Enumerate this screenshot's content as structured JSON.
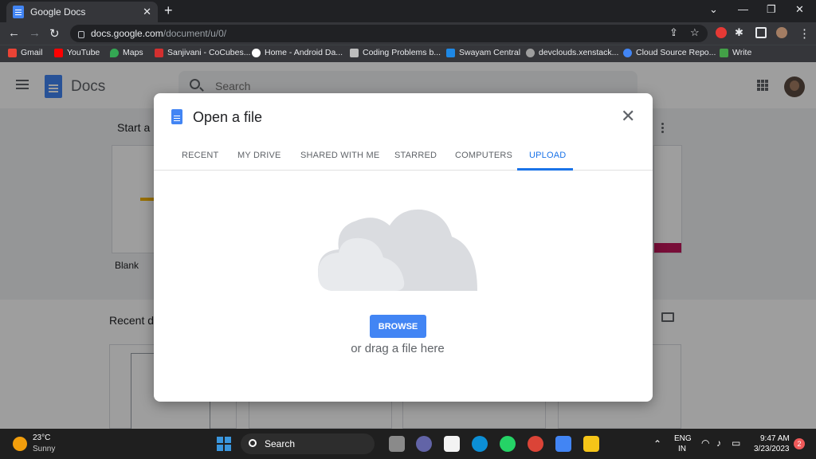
{
  "browser": {
    "tab_title": "Google Docs",
    "tab_close": "✕",
    "new_tab": "+",
    "url_host": "docs.google.com",
    "url_path": "/document/u/0/"
  },
  "bookmarks": [
    "Gmail",
    "YouTube",
    "Maps",
    "Sanjivani - CoCubes...",
    "Home - Android Da...",
    "Coding Problems b...",
    "Swayam Central",
    "devclouds.xenstack...",
    "Cloud Source Repo...",
    "Write"
  ],
  "docs": {
    "title": "Docs",
    "search_placeholder": "Search",
    "start_label": "Start a r",
    "blank_label": "Blank",
    "recent_label": "Recent d"
  },
  "dialog": {
    "title": "Open a file",
    "close": "✕",
    "tabs": [
      "RECENT",
      "MY DRIVE",
      "SHARED WITH ME",
      "STARRED",
      "COMPUTERS",
      "UPLOAD"
    ],
    "active_tab": "UPLOAD",
    "browse_label": "BROWSE",
    "drag_text": "or drag a file here"
  },
  "taskbar": {
    "temperature": "23°C",
    "condition": "Sunny",
    "search_label": "Search",
    "language": "ENG",
    "region": "IN",
    "time": "9:47 AM",
    "date": "3/23/2023",
    "notifications": "2"
  },
  "colors": {
    "accent": "#1a73e8",
    "browse_button": "#4285f4"
  }
}
